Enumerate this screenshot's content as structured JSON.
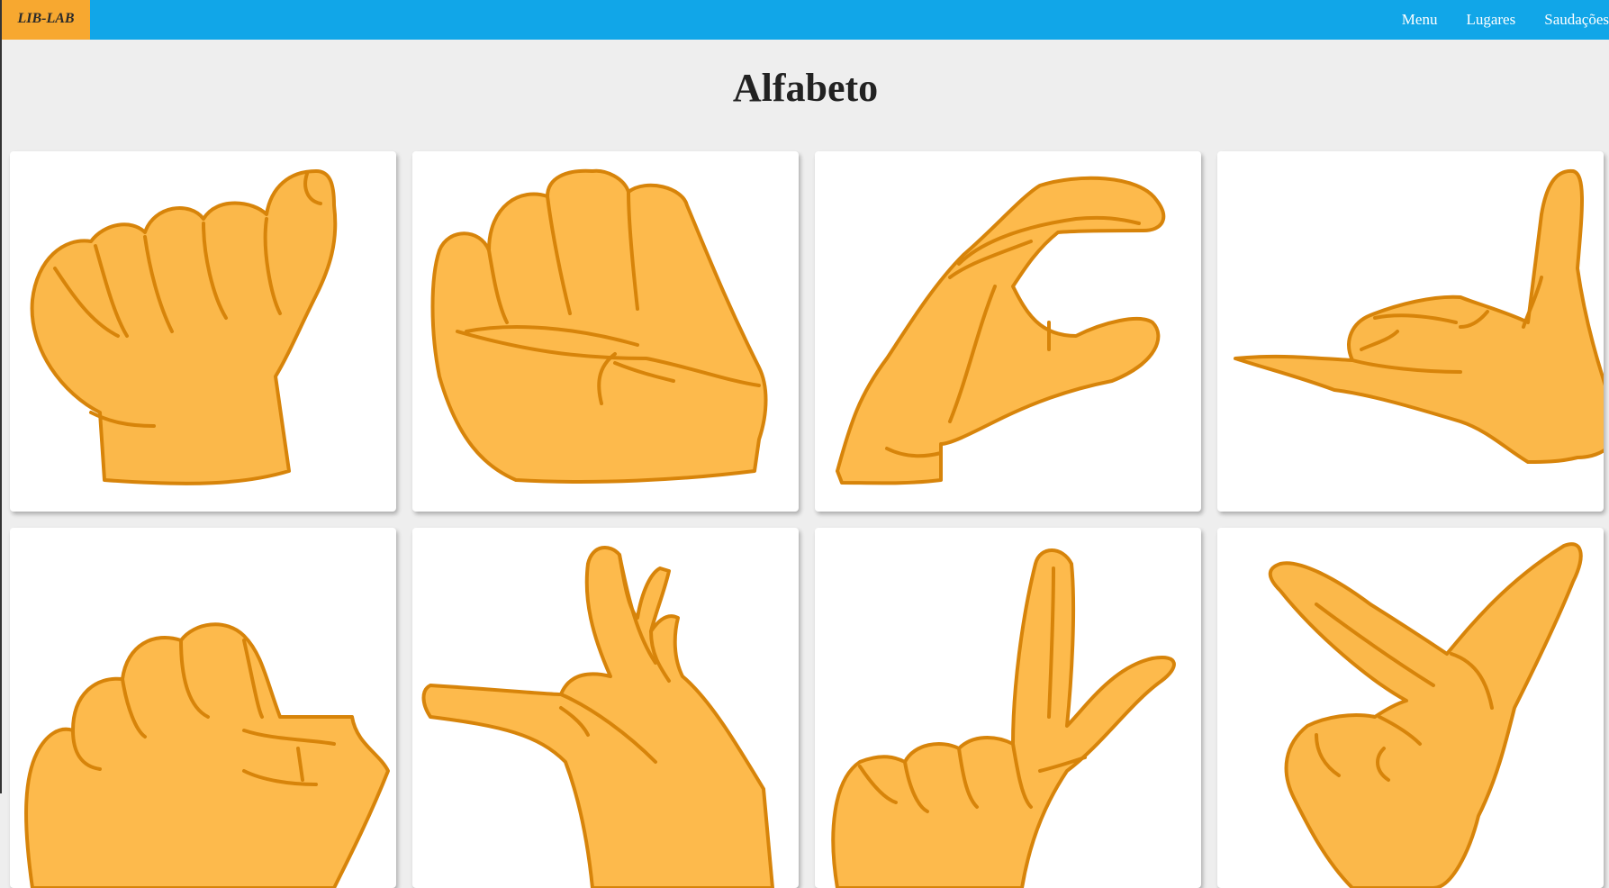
{
  "nav": {
    "brand": "LIB-LAB",
    "links": [
      "Menu",
      "Lugares",
      "Saudações"
    ]
  },
  "page": {
    "title": "Alfabeto"
  },
  "cards": [
    {
      "icon": "hand-sign-a-icon"
    },
    {
      "icon": "hand-sign-b-icon"
    },
    {
      "icon": "hand-sign-c-icon"
    },
    {
      "icon": "hand-sign-d-icon"
    },
    {
      "icon": "hand-sign-e-icon"
    },
    {
      "icon": "hand-sign-f-icon"
    },
    {
      "icon": "hand-sign-g-icon"
    },
    {
      "icon": "hand-sign-h-icon"
    }
  ],
  "colors": {
    "navbar": "#11a6e8",
    "brand_bg": "#f7a830",
    "page_bg": "#eeeeee",
    "hand_fill": "#fbb84a",
    "hand_stroke": "#d7840a"
  }
}
